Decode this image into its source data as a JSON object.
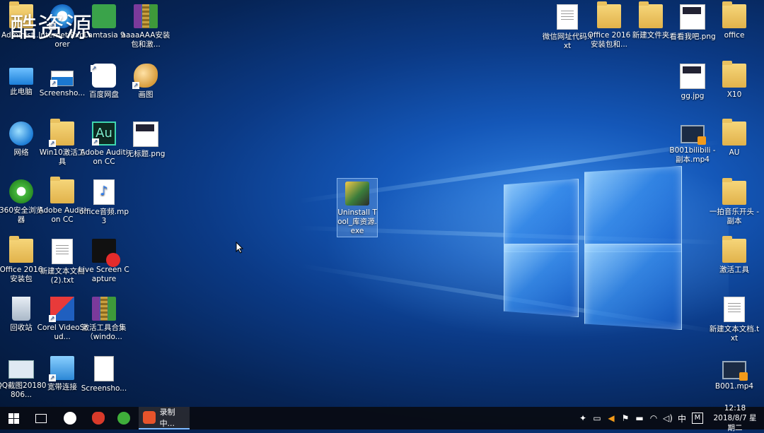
{
  "watermark": "酷资源",
  "colors": {
    "accent": "#1457b8",
    "taskbar": "#080c14",
    "recording_logo": "#e8542b"
  },
  "desktop_left": [
    {
      "label": "Administ...",
      "icon": "folder-icon"
    },
    {
      "label": "Internet Explorer",
      "icon": "ie-icon"
    },
    {
      "label": "Camtasia 9",
      "icon": "camtasia-icon"
    },
    {
      "label": "aaaaAAA安装包和激...",
      "icon": "winrar-icon"
    },
    {
      "label": "此电脑",
      "icon": "computer-icon"
    },
    {
      "label": "Screensho...",
      "icon": "screenshot-icon"
    },
    {
      "label": "百度网盘",
      "icon": "baidu-netdisk-icon"
    },
    {
      "label": "画图",
      "icon": "paint-icon"
    },
    {
      "label": "网络",
      "icon": "network-icon"
    },
    {
      "label": "Win10激活工具",
      "icon": "folder-icon"
    },
    {
      "label": "Adobe Audition CC",
      "icon": "audition-icon"
    },
    {
      "label": "无标题.png",
      "icon": "image-icon"
    },
    {
      "label": "360安全浏览器",
      "icon": "browser-360-icon"
    },
    {
      "label": "Adobe Audition CC",
      "icon": "folder-icon"
    },
    {
      "label": "office音频.mp3",
      "icon": "mp3-icon"
    },
    {
      "label": "Office 2016 安装包",
      "icon": "folder-icon"
    },
    {
      "label": "新建文本文档 (2).txt",
      "icon": "text-file-icon"
    },
    {
      "label": "Live Screen Capture",
      "icon": "live-screen-capture-icon"
    },
    {
      "label": "回收站",
      "icon": "recycle-bin-icon"
    },
    {
      "label": "Corel VideoStud...",
      "icon": "corel-icon"
    },
    {
      "label": "激活工具合集（windo...",
      "icon": "winrar-icon"
    },
    {
      "label": "QQ截图20180806...",
      "icon": "qq-screenshot-icon"
    },
    {
      "label": "宽带连接",
      "icon": "broadband-icon"
    },
    {
      "label": "Screensho...",
      "icon": "screenshot-icon"
    }
  ],
  "desktop_right": [
    {
      "label": "微信网址代码.txt",
      "icon": "text-file-icon"
    },
    {
      "label": "Office 2016 安装包和...",
      "icon": "folder-icon"
    },
    {
      "label": "新建文件夹",
      "icon": "folder-icon"
    },
    {
      "label": "看看我吧.png",
      "icon": "image-icon"
    },
    {
      "label": "office",
      "icon": "folder-icon"
    },
    {
      "label": "gg.jpg",
      "icon": "image-icon"
    },
    {
      "label": "X10",
      "icon": "folder-icon"
    },
    {
      "label": "B001bilibili - 副本.mp4",
      "icon": "video-icon"
    },
    {
      "label": "AU",
      "icon": "folder-icon"
    },
    {
      "label": "一拍音乐开头 - 副本",
      "icon": "folder-icon"
    },
    {
      "label": "激活工具",
      "icon": "folder-icon"
    },
    {
      "label": "新建文本文档.txt",
      "icon": "text-file-icon"
    },
    {
      "label": "B001.mp4",
      "icon": "video-icon"
    }
  ],
  "selected_icon": {
    "label": "Uninstall Tool_库资源.exe",
    "icon": "uninstall-tool-icon"
  },
  "taskbar": {
    "recording_label": "录制中...",
    "ime": "中",
    "ime_mode": "M",
    "time": "12:18",
    "date": "2018/8/7 星期二"
  }
}
